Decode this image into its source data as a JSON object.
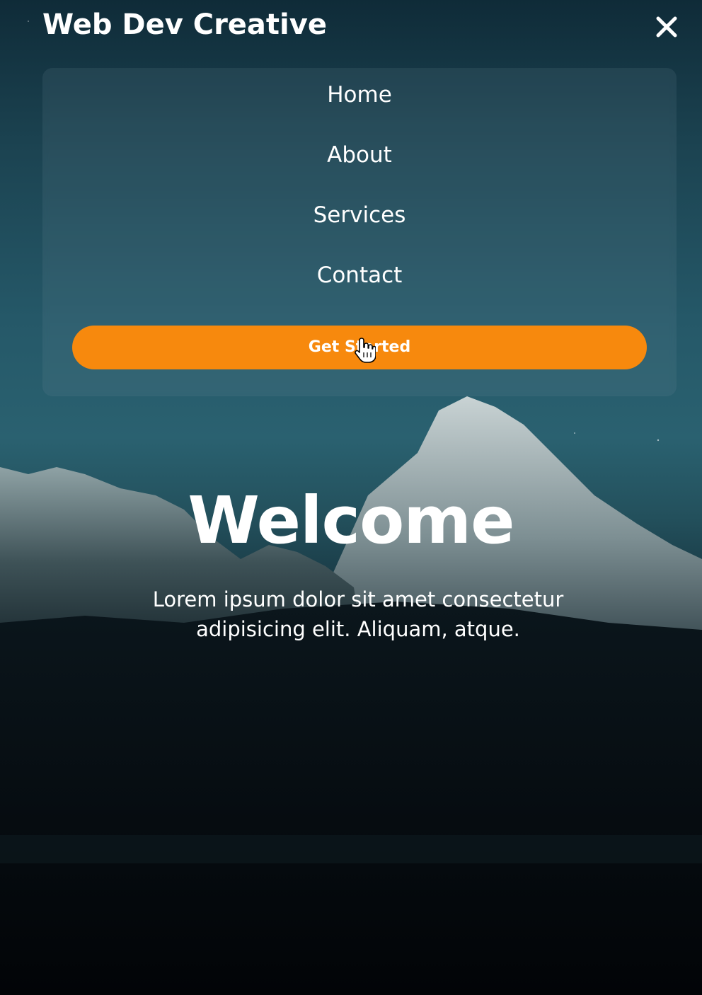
{
  "brand": {
    "title": "Web Dev Creative"
  },
  "header": {
    "close_icon": "close-icon"
  },
  "menu": {
    "items": [
      {
        "label": "Home"
      },
      {
        "label": "About"
      },
      {
        "label": "Services"
      },
      {
        "label": "Contact"
      }
    ],
    "cta_label": "Get Started"
  },
  "hero": {
    "title": "Welcome",
    "text": "Lorem ipsum dolor sit amet consectetur adipisicing elit. Aliquam, atque."
  },
  "colors": {
    "accent": "#f7890d",
    "text": "#ffffff",
    "background_top": "#0f2b38",
    "background_bottom": "#03060a"
  }
}
